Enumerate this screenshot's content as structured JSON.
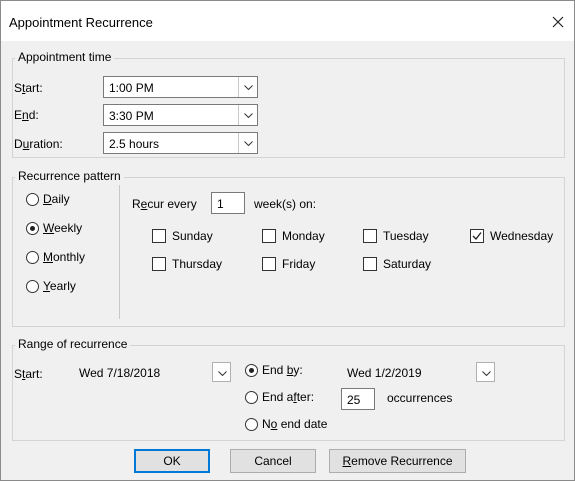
{
  "window": {
    "title": "Appointment Recurrence"
  },
  "appointment_time": {
    "title": "Appointment time",
    "start_label": "Start:",
    "start_value": "1:00 PM",
    "end_label": "End:",
    "end_value": "3:30 PM",
    "duration_label": "Duration:",
    "duration_value": "2.5 hours"
  },
  "recurrence_pattern": {
    "title": "Recurrence pattern",
    "frequencies": [
      "Daily",
      "Weekly",
      "Monthly",
      "Yearly"
    ],
    "selected_frequency": "Weekly",
    "recur_every_label": "Recur every",
    "recur_every_value": "1",
    "weeks_on_label": "week(s) on:",
    "days": [
      {
        "name": "Sunday",
        "checked": false
      },
      {
        "name": "Monday",
        "checked": false
      },
      {
        "name": "Tuesday",
        "checked": false
      },
      {
        "name": "Wednesday",
        "checked": true
      },
      {
        "name": "Thursday",
        "checked": false
      },
      {
        "name": "Friday",
        "checked": false
      },
      {
        "name": "Saturday",
        "checked": false
      }
    ]
  },
  "range": {
    "title": "Range of recurrence",
    "start_label": "Start:",
    "start_value": "Wed 7/18/2018",
    "end_by_label": "End by:",
    "end_by_value": "Wed 1/2/2019",
    "end_after_label": "End after:",
    "occurrences_value": "25",
    "occurrences_label": "occurrences",
    "no_end_label": "No end date",
    "selected": "End by"
  },
  "buttons": {
    "ok": "OK",
    "cancel": "Cancel",
    "remove": "Remove Recurrence"
  }
}
